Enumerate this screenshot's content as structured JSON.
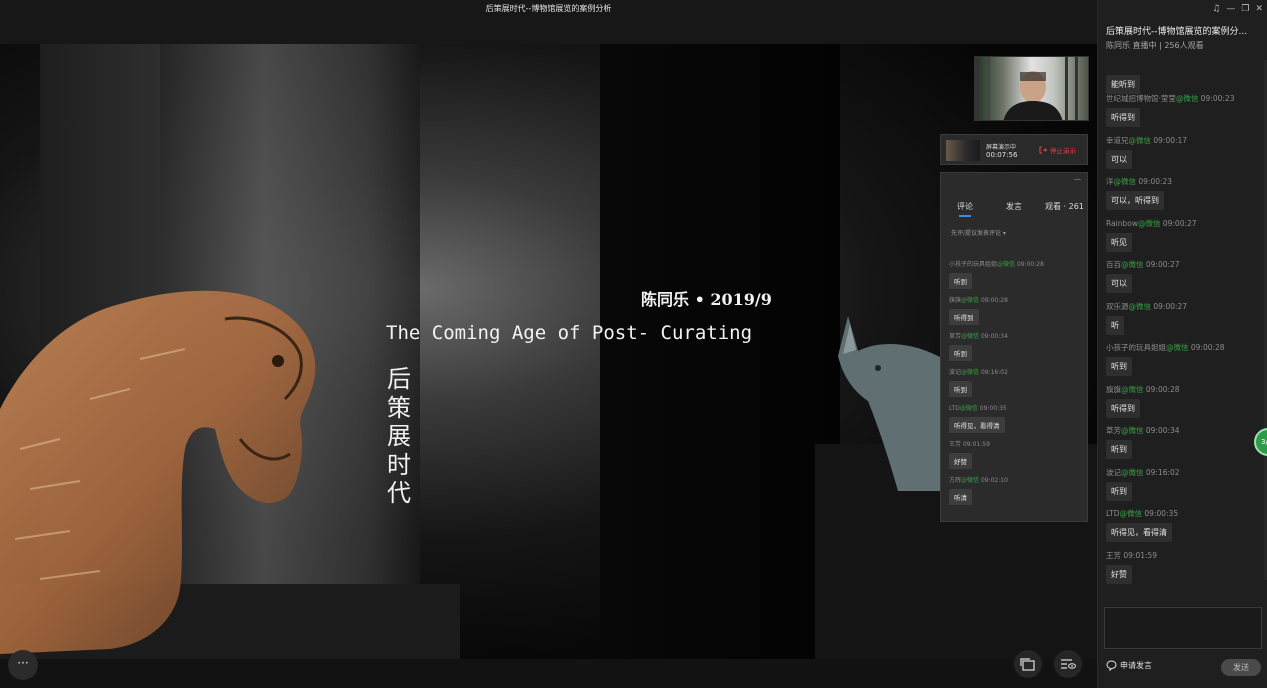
{
  "window": {
    "title": "后策展时代--博物馆展览的案例分析"
  },
  "slide": {
    "author": "陈同乐 • 2019/9",
    "title_en": "The Coming Age of Post- Curating",
    "title_cn": [
      "后",
      "策",
      "展",
      "时",
      "代"
    ]
  },
  "screen_share": {
    "status": "屏幕演示中",
    "timer": "00:07:56",
    "stop_label": "停止演示"
  },
  "mini_panel": {
    "minimize": "—",
    "tabs": [
      "评论",
      "发言",
      "观看 · 261"
    ],
    "filter": "先评/提议发表评论 ▾",
    "items": [
      {
        "user": "小孩子的玩具姐姐",
        "src": "@微信",
        "time": "09:00:28",
        "text": "听到"
      },
      {
        "user": "旗旗",
        "src": "@微信",
        "time": "09:00:28",
        "text": "听得到"
      },
      {
        "user": "草芳",
        "src": "@微信",
        "time": "09:00:34",
        "text": "听到"
      },
      {
        "user": "波记",
        "src": "@微信",
        "time": "09:16:02",
        "text": "听到"
      },
      {
        "user": "LTD",
        "src": "@微信",
        "time": "09:00:35",
        "text": "听得见，看得清"
      },
      {
        "user": "王芳",
        "src": "",
        "time": "09:01:59",
        "text": "好赞"
      },
      {
        "user": "方辉",
        "src": "@微信",
        "time": "09:02:10",
        "text": "听清"
      }
    ]
  },
  "controls": {
    "more": "···"
  },
  "sidebar": {
    "window_controls": [
      "♫",
      "—",
      "❐",
      "✕"
    ],
    "live_title": "后策展时代--博物馆展览的案例分...",
    "live_meta": "陈同乐 直播中 | 256人观看",
    "first_message": "能听到",
    "messages": [
      {
        "user": "世纪城招博物馆·莹莹",
        "src": "@微信",
        "time": "09:00:23",
        "text": "听得到"
      },
      {
        "user": "幸道兄",
        "src": "@微信",
        "time": "09:00:17",
        "text": "可以"
      },
      {
        "user": "洋",
        "src": "@微信",
        "time": "09:00:23",
        "text": "可以，听得到"
      },
      {
        "user": "Rainbow",
        "src": "@微信",
        "time": "09:00:27",
        "text": "听见"
      },
      {
        "user": "百百",
        "src": "@微信",
        "time": "09:00:27",
        "text": "可以"
      },
      {
        "user": "双乐源",
        "src": "@微信",
        "time": "09:00:27",
        "text": "听"
      },
      {
        "user": "小孩子的玩具姐姐",
        "src": "@微信",
        "time": "09:00:28",
        "text": "听到"
      },
      {
        "user": "旗旗",
        "src": "@微信",
        "time": "09:00:28",
        "text": "听得到"
      },
      {
        "user": "草芳",
        "src": "@微信",
        "time": "09:00:34",
        "text": "听到"
      },
      {
        "user": "波记",
        "src": "@微信",
        "time": "09:16:02",
        "text": "听到"
      },
      {
        "user": "LTD",
        "src": "@微信",
        "time": "09:00:35",
        "text": "听得见，看得清"
      },
      {
        "user": "王芳",
        "src": "",
        "time": "09:01:59",
        "text": "好赞"
      }
    ],
    "floater": "3/",
    "input_placeholder": "",
    "request_speak": "申请发言",
    "send": "发送"
  }
}
